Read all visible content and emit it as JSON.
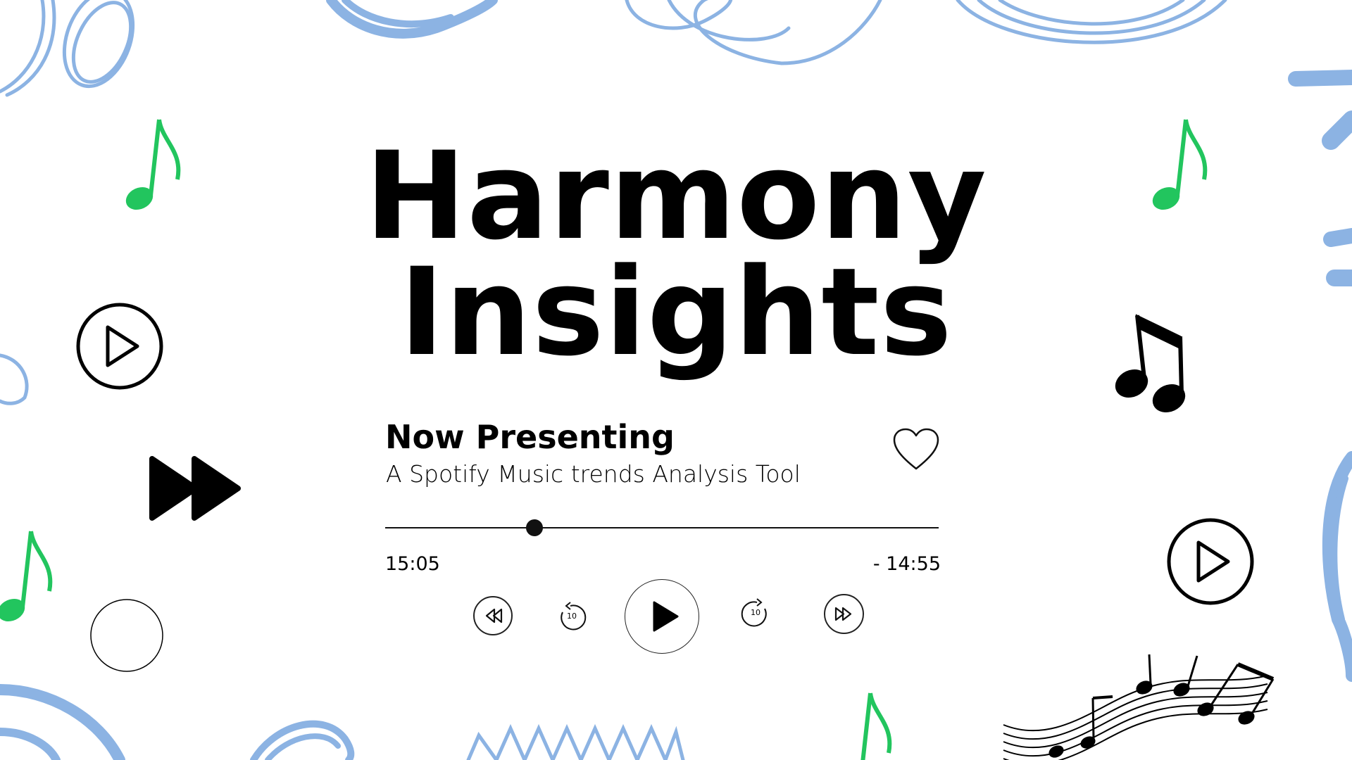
{
  "title": {
    "line1": "Harmony",
    "line2": "Insights"
  },
  "player": {
    "heading": "Now Presenting",
    "subtitle": "A Spotify Music trends Analysis Tool",
    "elapsed": "15:05",
    "remaining": "- 14:55",
    "progress_fraction": 0.27,
    "skip_back_label": "10",
    "skip_forward_label": "10"
  },
  "icons": {
    "like": "heart-icon",
    "rewind": "rewind-icon",
    "back10": "replay-10-icon",
    "play": "play-icon",
    "forward10": "forward-10-icon",
    "fastforward": "fast-forward-icon"
  },
  "colors": {
    "note_green": "#22c55e",
    "scribble_blue": "#8cb3e3",
    "ink": "#000000"
  }
}
